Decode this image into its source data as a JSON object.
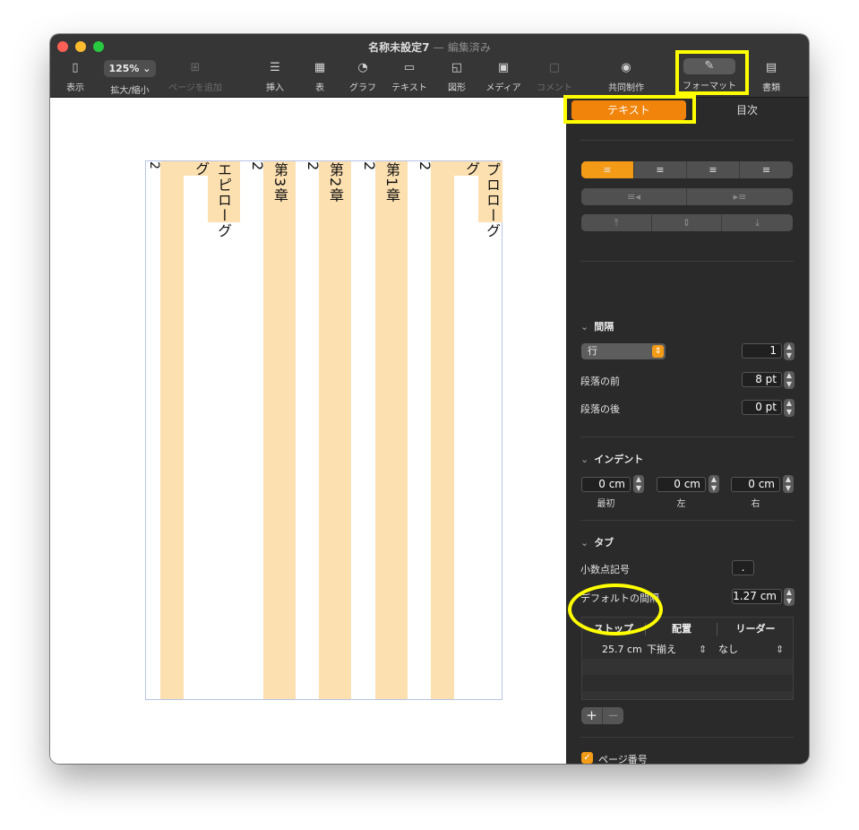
{
  "window": {
    "title": "名称未設定7",
    "separator": "—",
    "status": "編集済み"
  },
  "toolbar": {
    "view_label": "表示",
    "zoom_value": "125%",
    "zoom_label": "拡大/縮小",
    "add_page_label": "ページを追加",
    "insert_label": "挿入",
    "table_label": "表",
    "chart_label": "グラフ",
    "text_label": "テキスト",
    "shape_label": "図形",
    "media_label": "メディア",
    "comment_label": "コメント",
    "collaborate_label": "共同制作",
    "format_label": "フォーマット",
    "document_label": "書類",
    "icons": [
      "sidebar-icon",
      "add-page-icon",
      "insert-icon",
      "table-icon",
      "chart-icon",
      "text-icon",
      "shape-icon",
      "media-icon",
      "comment-icon",
      "collaborate-icon",
      "format-brush-icon",
      "document-icon"
    ]
  },
  "document": {
    "columns": [
      {
        "label": "プロローグ"
      },
      {
        "label": "2"
      },
      {
        "label": "第1章"
      },
      {
        "label": "2"
      },
      {
        "label": "第2章"
      },
      {
        "label": "2"
      },
      {
        "label": "第3章"
      },
      {
        "label": "2"
      },
      {
        "label": "エピローグ"
      }
    ],
    "column_color": "#fde0b0"
  },
  "panel": {
    "tabs": {
      "text": "テキスト",
      "toc": "目次"
    },
    "accent_color": "#f39a17",
    "spacing": {
      "title": "間隔",
      "line_mode": "行",
      "line_value": "1",
      "before_label": "段落の前",
      "before_value": "8 pt",
      "after_label": "段落の後",
      "after_value": "0 pt"
    },
    "indent": {
      "title": "インデント",
      "first_value": "0 cm",
      "first_label": "最初",
      "left_value": "0 cm",
      "left_label": "左",
      "right_value": "0 cm",
      "right_label": "右"
    },
    "tabs_section": {
      "title": "タブ",
      "decimal_label": "小数点記号",
      "decimal_value": ".",
      "default_label": "デフォルトの間隔",
      "default_value": "1.27 cm",
      "headers": {
        "stop": "ストップ",
        "align": "配置",
        "leader": "リーダー"
      },
      "rows": [
        {
          "stop": "25.7 cm",
          "align": "下揃え",
          "leader": "なし"
        }
      ],
      "add": "+",
      "remove": "−"
    },
    "page_number": {
      "label": "ページ番号",
      "checked": true
    }
  }
}
